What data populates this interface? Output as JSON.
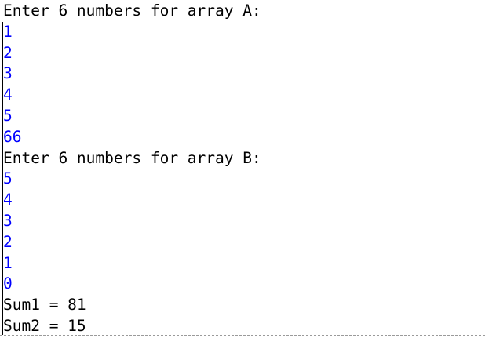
{
  "console": {
    "prompt_a": "Enter 6 numbers for array A:",
    "inputs_a": [
      "1",
      "2",
      "3",
      "4",
      "5",
      "66"
    ],
    "prompt_b": "Enter 6 numbers for array B:",
    "inputs_b": [
      "5",
      "4",
      "3",
      "2",
      "1",
      "0"
    ],
    "sum1": "Sum1 = 81",
    "sum2": "Sum2 = 15"
  },
  "colors": {
    "output_text": "#000000",
    "input_text": "#0000ff",
    "background": "#ffffff"
  }
}
